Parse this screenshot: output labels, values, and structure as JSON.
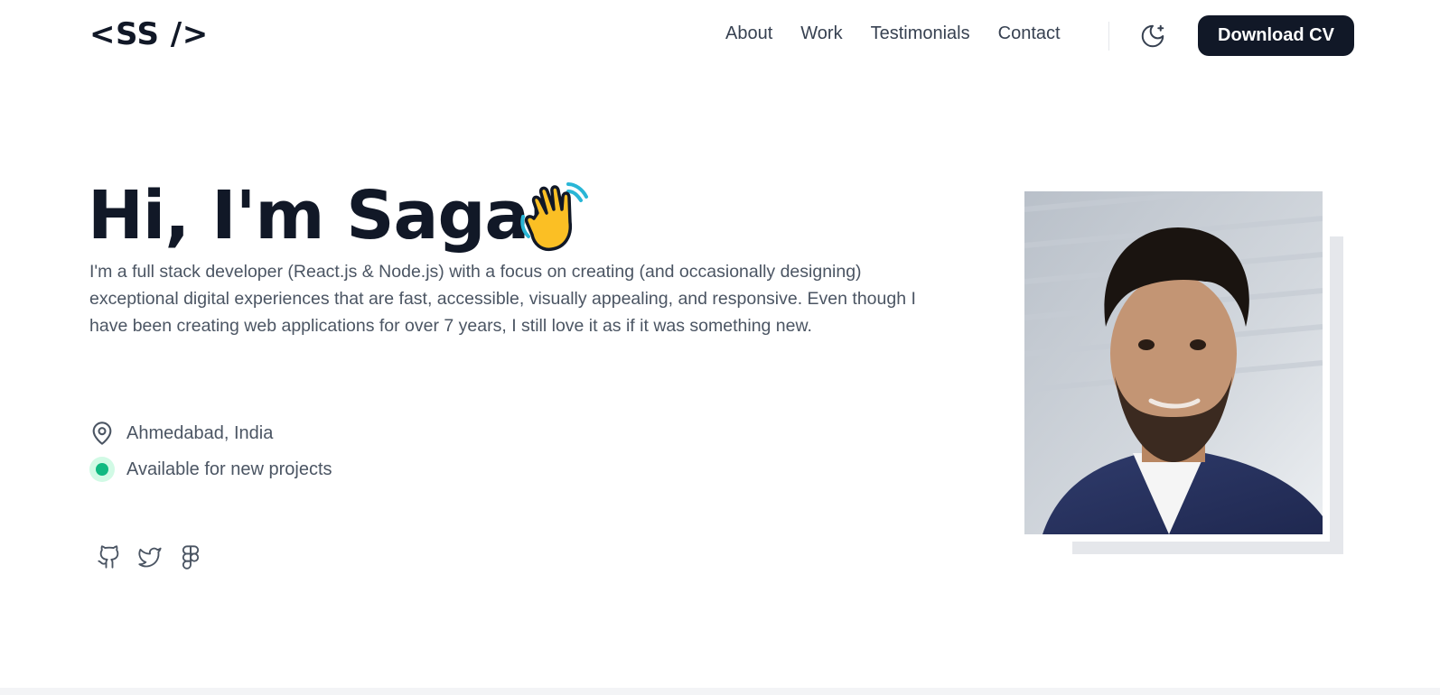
{
  "header": {
    "logo": "<SS />",
    "nav": [
      {
        "label": "About"
      },
      {
        "label": "Work"
      },
      {
        "label": "Testimonials"
      },
      {
        "label": "Contact"
      }
    ],
    "theme_toggle_icon": "moon-icon",
    "cv_button_label": "Download CV"
  },
  "hero": {
    "title": "Hi, I'm Sagar",
    "emoji": "waving-hand-icon",
    "description": "I'm a full stack developer (React.js & Node.js) with a focus on creating (and occasionally designing) exceptional digital experiences that are fast, accessible, visually appealing, and responsive. Even though I have been creating web applications for over 7 years, I still love it as if it was something new.",
    "location": "Ahmedabad, India",
    "availability": "Available for new projects",
    "socials": [
      {
        "icon": "github-icon"
      },
      {
        "icon": "twitter-icon"
      },
      {
        "icon": "figma-icon"
      }
    ]
  },
  "colors": {
    "primary": "#111827",
    "text_muted": "#4b5563",
    "status_green": "#10b981",
    "status_green_bg": "#d1fae5",
    "frame_gray": "#e5e7eb"
  }
}
